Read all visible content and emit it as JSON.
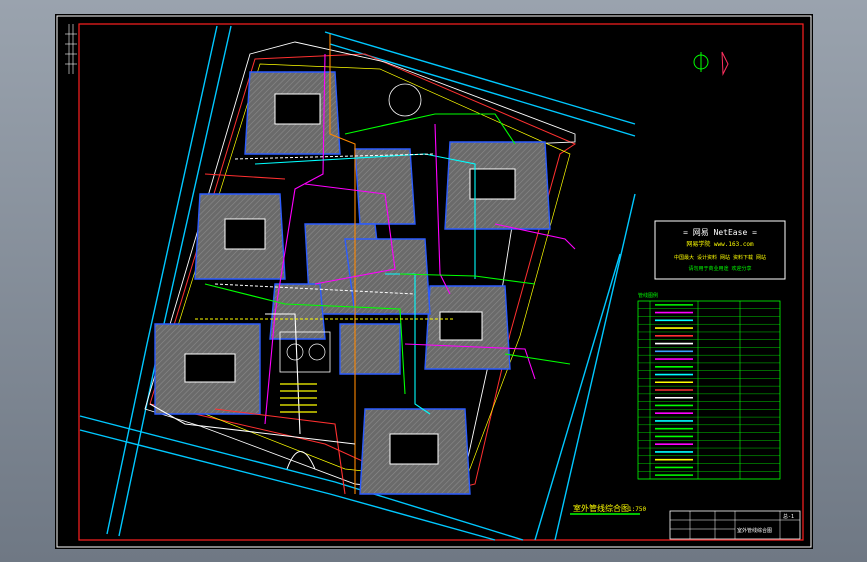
{
  "drawing": {
    "background": "#000000",
    "border_color": "#ff2020",
    "title_plan": "室外管线综合图",
    "scale": "1:750",
    "north_symbol": "north-arrow-icon"
  },
  "stamp": {
    "brand_line": "= 网易 NetEase =",
    "site_line": "网易学院 www.163.com",
    "line3": "中国最大 设计资料 网站 资料下载 网站",
    "line4": "请勿用于商业用途 欢迎分享"
  },
  "legend": {
    "title": "管线图例",
    "colors": [
      "#00ff00",
      "#ff00ff",
      "#00ffff",
      "#ffff00",
      "#ff3030",
      "#ffffff",
      "#3aa0ff",
      "#ff00ff",
      "#00ff00",
      "#00ffff",
      "#ffff00",
      "#ff3030",
      "#ffffff",
      "#00ff00",
      "#ff00ff",
      "#00ffff",
      "#00ff00",
      "#00ff00",
      "#ff00ff",
      "#00ffff",
      "#ffff00",
      "#00ff00",
      "#00ff00"
    ]
  },
  "title_block": {
    "drawing_name": "室外管线综合图",
    "sheet_no": "总-1"
  }
}
